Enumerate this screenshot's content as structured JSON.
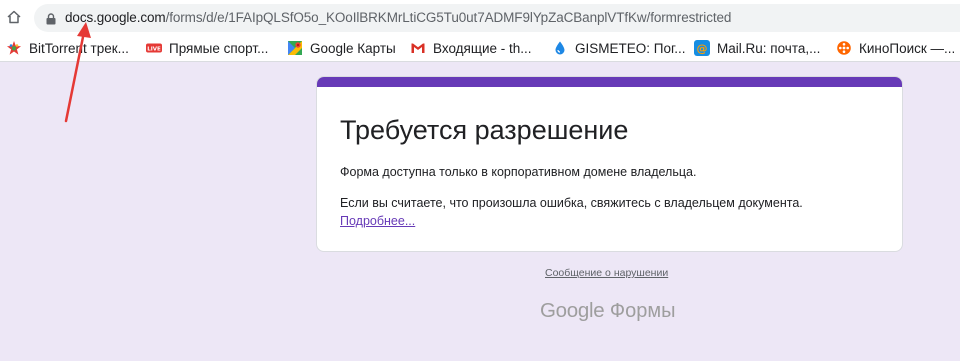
{
  "browser": {
    "url_host": "docs.google.com",
    "url_path": "/forms/d/e/1FAIpQLSfO5o_KOoIlBRKMrLtiCG5Tu0ut7ADMF9lYpZaCBanplVTfKw/formrestricted"
  },
  "bookmarks": [
    {
      "label": "BitTorrent трек...",
      "icon": "bittorrent-icon"
    },
    {
      "label": "Прямые спорт...",
      "icon": "live-icon"
    },
    {
      "label": "Google Карты",
      "icon": "maps-icon"
    },
    {
      "label": "Входящие - th...",
      "icon": "gmail-icon"
    },
    {
      "label": "GISMETEO: Пог...",
      "icon": "gismeteo-icon"
    },
    {
      "label": "Mail.Ru: почта,...",
      "icon": "mailru-icon"
    },
    {
      "label": "КиноПоиск —...",
      "icon": "kinopoisk-icon"
    }
  ],
  "card": {
    "title": "Требуется разрешение",
    "text1": "Форма доступна только в корпоративном домене владельца.",
    "text2": "Если вы считаете, что произошла ошибка, свяжитесь с владельцем документа.",
    "link": "Подробнее..."
  },
  "footer": {
    "report": "Сообщение о нарушении",
    "brand_google": "Google",
    "brand_product": "Формы"
  },
  "colors": {
    "accent": "#673ab7",
    "background": "#ede7f6",
    "annotation_arrow": "#e53935"
  }
}
